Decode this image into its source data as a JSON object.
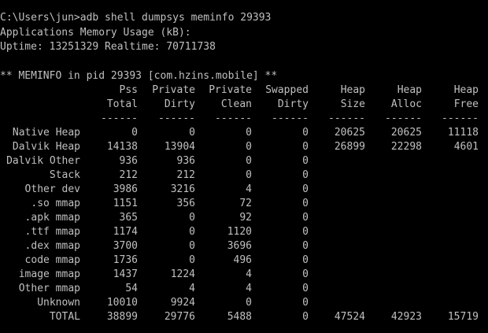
{
  "terminal": {
    "command_line": "C:\\Users\\jun>adb shell dumpsys meminfo 29393",
    "app_mem_title": "Applications Memory Usage (kB):",
    "uptime_line": "Uptime: 13251329 Realtime: 70711738",
    "meminfo_header": "** MEMINFO in pid 29393 [com.hzins.mobile] **"
  },
  "table": {
    "header_row1": [
      "Pss",
      "Private",
      "Private",
      "Swapped",
      "Heap",
      "Heap",
      "Heap"
    ],
    "header_row2": [
      "Total",
      "Dirty",
      "Clean",
      "Dirty",
      "Size",
      "Alloc",
      "Free"
    ],
    "separator": [
      "------",
      "------",
      "------",
      "------",
      "------",
      "------",
      "------"
    ],
    "rows": [
      {
        "label": "Native Heap",
        "values": [
          "0",
          "0",
          "0",
          "0",
          "20625",
          "20625",
          "11118"
        ]
      },
      {
        "label": "Dalvik Heap",
        "values": [
          "14138",
          "13904",
          "0",
          "0",
          "26899",
          "22298",
          "4601"
        ]
      },
      {
        "label": "Dalvik Other",
        "values": [
          "936",
          "936",
          "0",
          "0",
          "",
          "",
          ""
        ]
      },
      {
        "label": "Stack",
        "values": [
          "212",
          "212",
          "0",
          "0",
          "",
          "",
          ""
        ]
      },
      {
        "label": "Other dev",
        "values": [
          "3986",
          "3216",
          "4",
          "0",
          "",
          "",
          ""
        ]
      },
      {
        "label": ".so mmap",
        "values": [
          "1151",
          "356",
          "72",
          "0",
          "",
          "",
          ""
        ]
      },
      {
        "label": ".apk mmap",
        "values": [
          "365",
          "0",
          "92",
          "0",
          "",
          "",
          ""
        ]
      },
      {
        "label": ".ttf mmap",
        "values": [
          "1174",
          "0",
          "1120",
          "0",
          "",
          "",
          ""
        ]
      },
      {
        "label": ".dex mmap",
        "values": [
          "3700",
          "0",
          "3696",
          "0",
          "",
          "",
          ""
        ]
      },
      {
        "label": "code mmap",
        "values": [
          "1736",
          "0",
          "496",
          "0",
          "",
          "",
          ""
        ]
      },
      {
        "label": "image mmap",
        "values": [
          "1437",
          "1224",
          "4",
          "0",
          "",
          "",
          ""
        ]
      },
      {
        "label": "Other mmap",
        "values": [
          "54",
          "4",
          "4",
          "0",
          "",
          "",
          ""
        ]
      },
      {
        "label": "Unknown",
        "values": [
          "10010",
          "9924",
          "0",
          "0",
          "",
          "",
          ""
        ]
      },
      {
        "label": "TOTAL",
        "values": [
          "38899",
          "29776",
          "5488",
          "0",
          "47524",
          "42923",
          "15719"
        ]
      }
    ]
  }
}
